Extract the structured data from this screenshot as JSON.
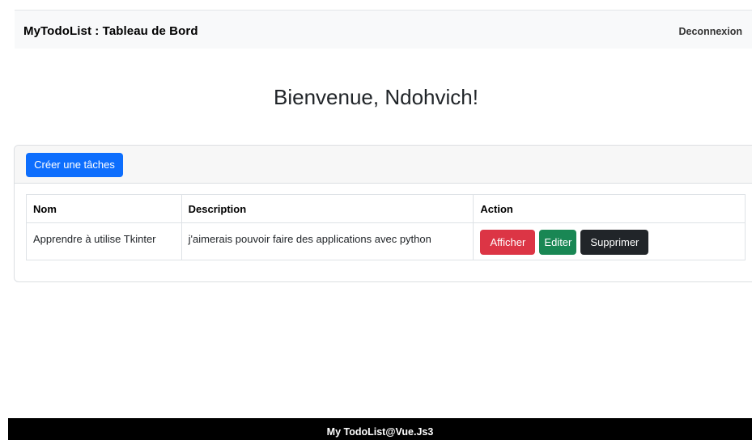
{
  "navbar": {
    "brand": "MyTodoList : Tableau de Bord",
    "logout_label": "Deconnexion"
  },
  "welcome": {
    "title": "Bienvenue, Ndohvich!"
  },
  "tasks": {
    "create_label": "Créer une tâches",
    "columns": [
      "Nom",
      "Description",
      "Action"
    ],
    "rows": [
      {
        "name": "Apprendre à utilise Tkinter",
        "description": "j'aimerais pouvoir faire des applications avec python",
        "actions": {
          "show": "Afficher",
          "edit": "Editer",
          "delete": "Supprimer"
        }
      }
    ]
  },
  "footer": {
    "text": "My TodoList@Vue.Js3"
  },
  "colors": {
    "primary": "#0d6efd",
    "danger": "#dc3545",
    "success": "#198754",
    "dark": "#212529",
    "footer_bg": "#000000"
  }
}
